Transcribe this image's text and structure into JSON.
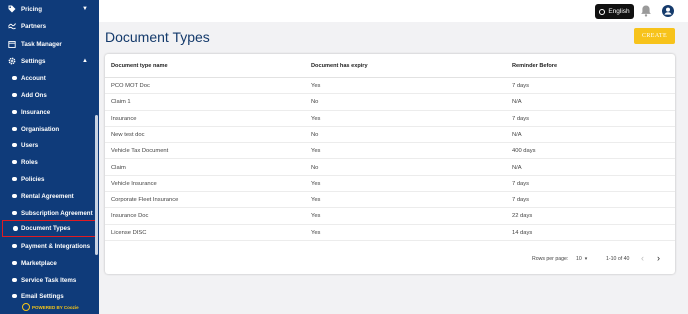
{
  "sidebar": {
    "items": [
      {
        "label": "Pricing",
        "icon": "tag-icon",
        "chev": "▼"
      },
      {
        "label": "Partners",
        "icon": "handshake-icon"
      },
      {
        "label": "Task Manager",
        "icon": "calendar-icon"
      },
      {
        "label": "Settings",
        "icon": "gear-icon",
        "chev": "▲"
      }
    ],
    "sub_items": [
      "Account",
      "Add Ons",
      "Insurance",
      "Organisation",
      "Users",
      "Roles",
      "Policies",
      "Rental Agreement",
      "Subscription Agreement",
      "Document Types",
      "Payment & Integrations",
      "Marketplace",
      "Service Task Items",
      "Email Settings"
    ],
    "powered_by": "POWERED BY Coozie"
  },
  "topbar": {
    "language": "English"
  },
  "page": {
    "title": "Document Types",
    "create_label": "CREATE"
  },
  "table": {
    "headers": [
      "Document type name",
      "Document has expiry",
      "Reminder Before"
    ],
    "rows": [
      [
        "PCO MOT Doc",
        "Yes",
        "7 days"
      ],
      [
        "Claim 1",
        "No",
        "N/A"
      ],
      [
        "Insurance",
        "Yes",
        "7 days"
      ],
      [
        "New test doc",
        "No",
        "N/A"
      ],
      [
        "Vehicle Tax Document",
        "Yes",
        "400 days"
      ],
      [
        "Claim",
        "No",
        "N/A"
      ],
      [
        "Vehicle Insurance",
        "Yes",
        "7 days"
      ],
      [
        "Corporate Fleet Insurance",
        "Yes",
        "7 days"
      ],
      [
        "Insurance Doc",
        "Yes",
        "22 days"
      ],
      [
        "License DISC",
        "Yes",
        "14 days"
      ]
    ]
  },
  "pagination": {
    "rows_per_page_label": "Rows per page:",
    "rows_per_page": "10",
    "range": "1-10 of 40"
  }
}
